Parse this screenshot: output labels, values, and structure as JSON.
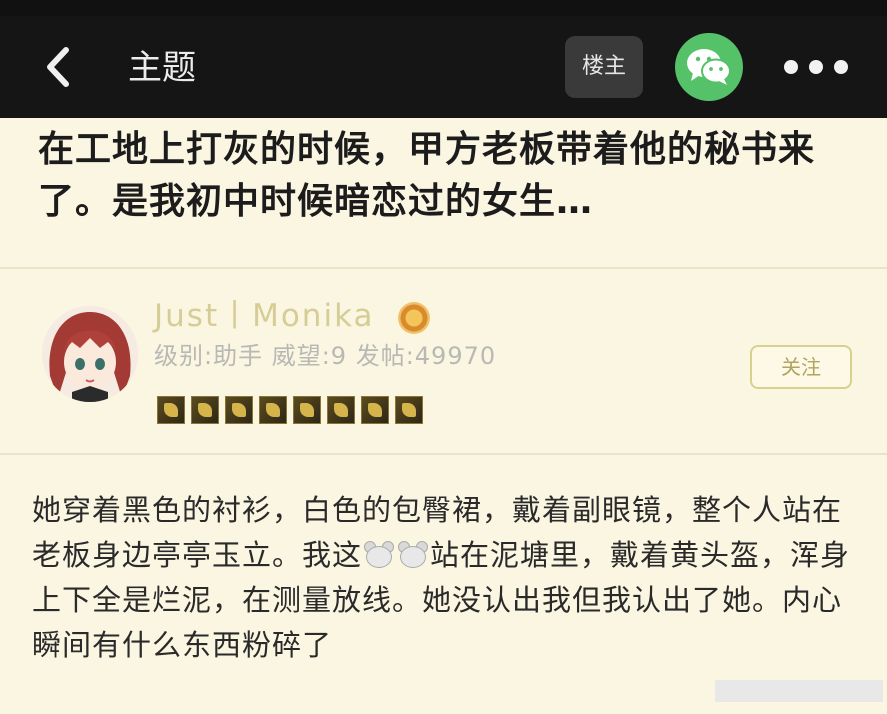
{
  "header": {
    "title": "主题",
    "louzhu_label": "楼主",
    "back_icon": "chevron-left-icon",
    "share_icon": "wechat-icon",
    "more_icon": "more-dots-icon",
    "colors": {
      "bar": "#151515",
      "wechat": "#55c26a"
    }
  },
  "post": {
    "title": "在工地上打灰的时候，甲方老板带着他的秘书来了。是我初中时候暗恋过的女生…"
  },
  "author": {
    "username": "Just丨Monika",
    "stats": "级别:助手 威望:9 发帖:49970",
    "follow_label": "关注",
    "medal_count": 8,
    "colors": {
      "username": "#d6cd96",
      "follow_border": "#d9cf8e"
    }
  },
  "content": {
    "part1": "她穿着黑色的衬衫，白色的包臀裙，戴着副眼镜，整个人站在老板身边亭亭玉立。我这",
    "part2": "站在泥塘里，戴着黄头盔，浑身上下全是烂泥，在测量放线。她没认出我但我认出了她。内心瞬间有什么东西粉碎了",
    "emoji": "mouse-face-icon"
  }
}
